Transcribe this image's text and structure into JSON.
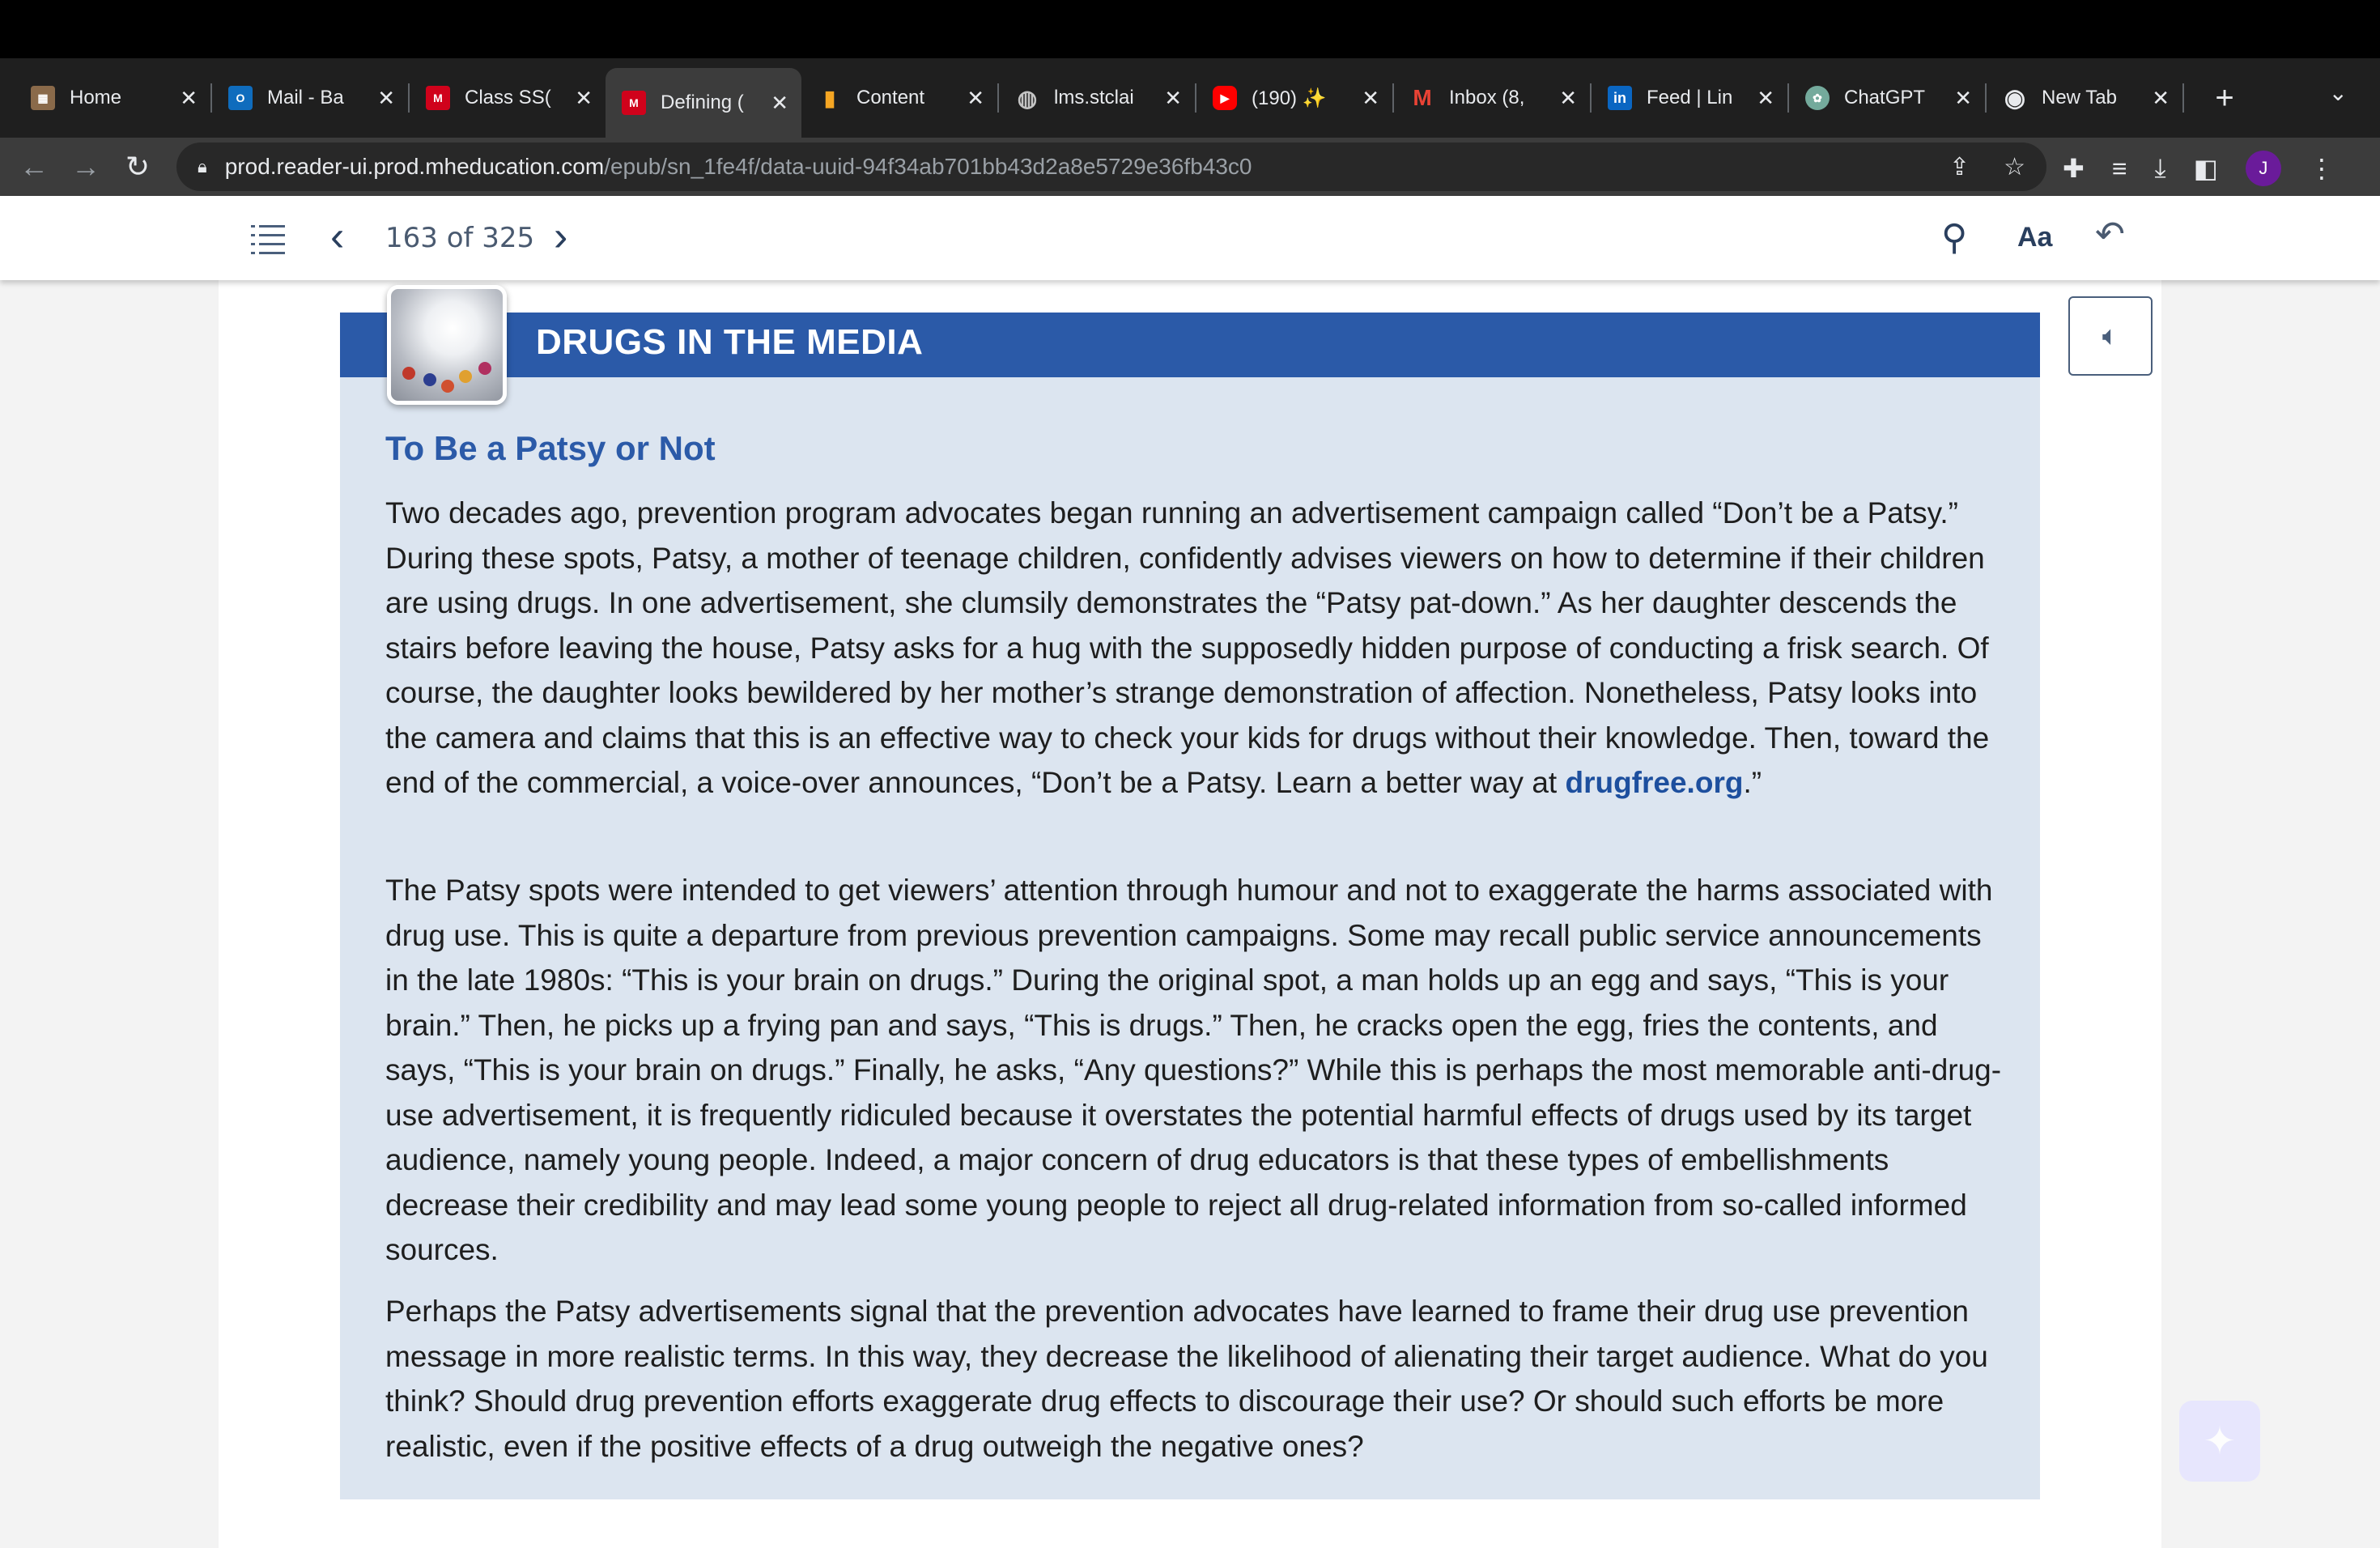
{
  "browser": {
    "tabs": [
      {
        "title": "Home",
        "favicon": "home-icon",
        "favicon_color": "#c4c4c4",
        "active": false
      },
      {
        "title": "Mail - Ba",
        "favicon": "outlook-icon",
        "favicon_color": "#0f6cbd",
        "active": false
      },
      {
        "title": "Class SS(",
        "favicon": "mcgraw-hill-icon",
        "favicon_color": "#d0021b",
        "active": false
      },
      {
        "title": "Defining (",
        "favicon": "mcgraw-hill-icon",
        "favicon_color": "#d0021b",
        "active": true
      },
      {
        "title": "Content",
        "favicon": "bar-chart-icon",
        "favicon_color": "#f5a623",
        "active": false
      },
      {
        "title": "lms.stclai",
        "favicon": "globe-icon",
        "favicon_color": "#9aa0a6",
        "active": false
      },
      {
        "title": "(190) ✨",
        "favicon": "youtube-icon",
        "favicon_color": "#ff0000",
        "active": false
      },
      {
        "title": "Inbox (8,",
        "favicon": "gmail-icon",
        "favicon_color": "#ea4335",
        "active": false
      },
      {
        "title": "Feed | Lin",
        "favicon": "linkedin-icon",
        "favicon_color": "#0a66c2",
        "active": false
      },
      {
        "title": "ChatGPT",
        "favicon": "chatgpt-icon",
        "favicon_color": "#74aa9c",
        "active": false
      },
      {
        "title": "New Tab",
        "favicon": "chrome-icon",
        "favicon_color": "#9aa0a6",
        "active": false
      }
    ],
    "url_host": "prod.reader-ui.prod.mheducation.com",
    "url_path": "/epub/sn_1fe4f/data-uuid-94f34ab701bb43d2a8e5729e36fb43c0",
    "profile_initial": "J"
  },
  "reader": {
    "page_indicator": "163 of 325",
    "font_button_label": "Aa"
  },
  "content": {
    "feature_title": "DRUGS IN THE MEDIA",
    "subhead": "To Be a Patsy or Not",
    "p1_text": "Two decades ago, prevention program advocates began running an advertisement campaign called “Don’t be a Patsy.” During these spots, Patsy, a mother of teenage children, confidently advises viewers on how to determine if their children are using drugs. In one advertisement, she clumsily demonstrates the “Patsy pat-down.” As her daughter descends the stairs before leaving the house, Patsy asks for a hug with the supposedly hidden purpose of conducting a frisk search. Of course, the daughter looks bewildered by her mother’s strange demonstration of affection. Nonetheless, Patsy looks into the camera and claims that this is an effective way to check your kids for drugs without their knowledge. Then, toward the end of the commercial, a voice-over announces, “Don’t be a Patsy. Learn a better way at ",
    "p1_link": "drugfree.org",
    "p1_end": ".”",
    "p2_text": "The Patsy spots were intended to get viewers’ attention through humour and not to exaggerate the harms associated with drug use. This is quite a departure from previous prevention campaigns. Some may recall public service announcements in the late 1980s: “This is your brain on drugs.” During the original spot, a man holds up an egg and says, “This is your brain.” Then, he picks up a frying pan and says, “This is drugs.” Then, he cracks open the egg, fries the contents, and says, “This is your brain on drugs.” Finally, he asks, “Any questions?” While this is perhaps the most memorable anti-drug-use advertisement, it is frequently ridiculed because it overstates the potential harmful effects of drugs used by its target audience, namely young people. Indeed, a major concern of drug educators is that these types of embellishments decrease their credibility and may lead some young people to reject all drug-related information from so-called informed sources.",
    "p3_text": "Perhaps the Patsy advertisements signal that the prevention advocates have learned to frame their drug use prevention message in more realistic terms. In this way, they decrease the likelihood of alienating their target audience. What do you think? Should drug prevention efforts exaggerate drug effects to discourage their use? Or should such efforts be more realistic, even if the positive effects of a drug outweigh the negative ones?"
  },
  "colors": {
    "feature_header": "#2b5aa8",
    "feature_background": "#dce5f0",
    "link": "#1d4f9e"
  }
}
